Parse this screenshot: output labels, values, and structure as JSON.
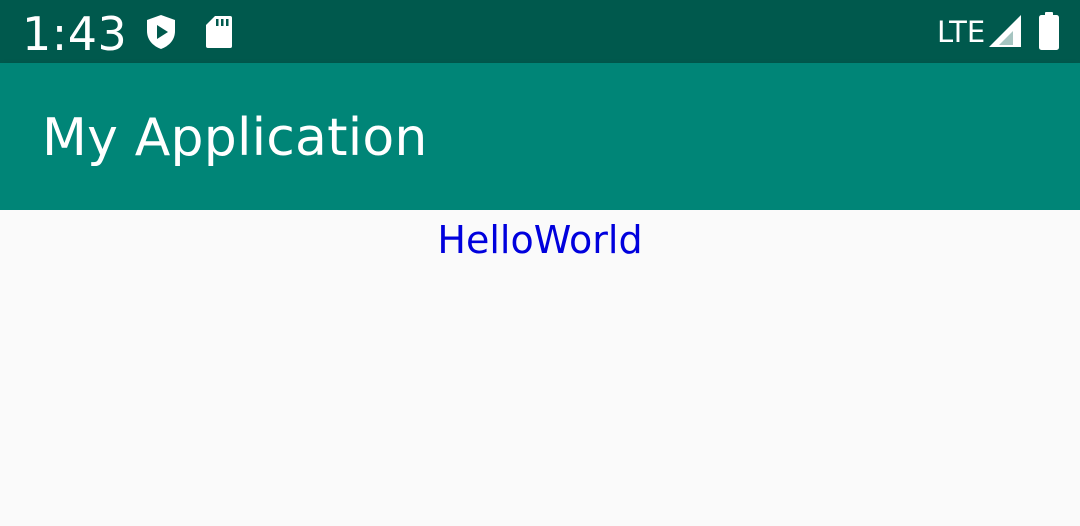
{
  "status_bar": {
    "time": "1:43",
    "network": "LTE",
    "icons": {
      "notification_1": "play-protect-shield-icon",
      "notification_2": "sd-card-icon",
      "signal": "cell-signal-icon",
      "battery": "battery-icon"
    },
    "background_color": "#00594d"
  },
  "app_bar": {
    "title": "My Application",
    "background_color": "#008577",
    "text_color": "#ffffff"
  },
  "content": {
    "text": "HelloWorld",
    "text_color": "#0000dd",
    "background_color": "#fafafa"
  }
}
